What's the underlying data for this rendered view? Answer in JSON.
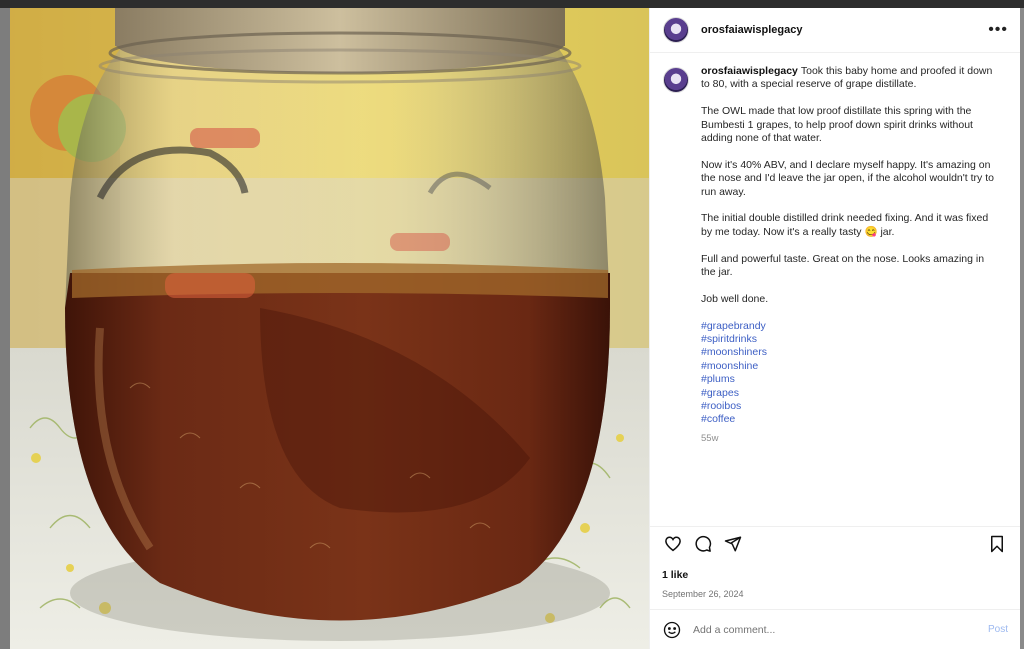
{
  "post": {
    "username": "orosfaiawisplegacy",
    "more_icon": "more-horizontal-icon",
    "caption": {
      "username": "orosfaiawisplegacy",
      "first": "Took this baby home and proofed it down to 80, with a special reserve of grape distillate.",
      "paragraphs": [
        "The OWL made that low proof distillate this spring with the Bumbesti 1 grapes, to help proof down spirit drinks without adding none of that water.",
        "Now it's 40% ABV, and I declare myself happy. It's amazing on the nose and I'd leave the jar open, if the alcohol wouldn't try to run away.",
        "The initial double distilled drink needed fixing. And it was fixed by me today. Now it's a really tasty 😋 jar.",
        "Full and powerful taste. Great on the nose. Looks amazing in the jar.",
        "Job well done."
      ],
      "hashtags": [
        "#grapebrandy",
        "#spiritdrinks",
        "#moonshiners",
        "#moonshine",
        "#plums",
        "#grapes",
        "#rooibos",
        "#coffee"
      ],
      "age": "55w"
    },
    "actions": {
      "like_icon": "heart-icon",
      "comment_icon": "comment-icon",
      "share_icon": "send-icon",
      "save_icon": "bookmark-icon"
    },
    "likes": "1 like",
    "date": "September 26, 2024",
    "comment_box": {
      "emoji_icon": "smiley-icon",
      "placeholder": "Add a comment...",
      "post_label": "Post"
    },
    "colors": {
      "link": "#3d5fc4",
      "post_button": "#9db9f0",
      "liquid": "#6b2a15"
    }
  }
}
